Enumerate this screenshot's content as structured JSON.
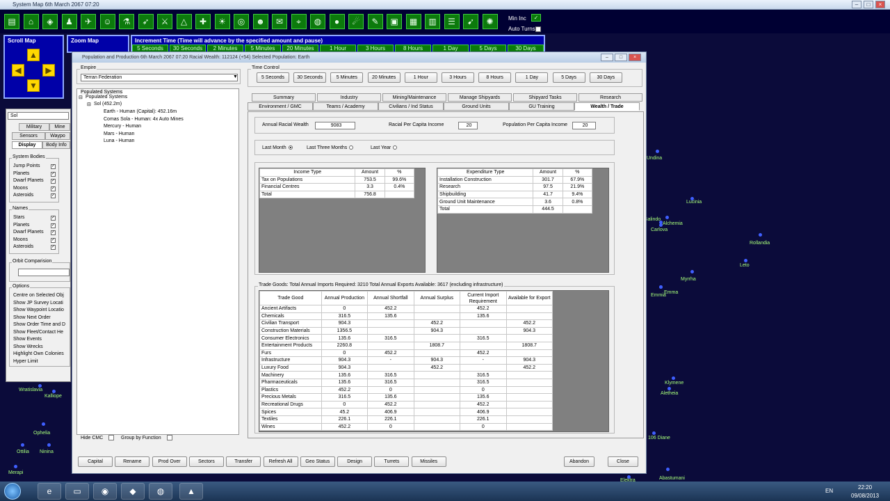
{
  "system_window": {
    "title": "System Map  6th March 2067 07:20"
  },
  "toolbar": {
    "min_inc_label": "Min Inc",
    "auto_turns_label": "Auto Turns",
    "icons": [
      "production-icon",
      "industry-icon",
      "ship-design-icon",
      "pilot-icon",
      "fleet-icon",
      "commander-icon",
      "research-icon",
      "missile-icon",
      "ground-forces-icon",
      "triangle-icon",
      "crosshair-icon",
      "sun-icon",
      "radar-icon",
      "alien-icon",
      "intel-icon",
      "station-icon",
      "globe-icon",
      "planet-icon",
      "satellite-icon",
      "design-icon",
      "monitor-icon",
      "grid-icon",
      "chart-icon",
      "list-icon",
      "rocket-icon",
      "galaxy-icon"
    ]
  },
  "increment": {
    "title": "Increment Time (Time will advance by the specified amount and pause)",
    "buttons": [
      "5 Seconds",
      "30 Seconds",
      "2 Minutes",
      "5 Minutes",
      "20 Minutes",
      "1 Hour",
      "3 Hours",
      "8 Hours",
      "1 Day",
      "5 Days",
      "30 Days"
    ]
  },
  "scroll_map": {
    "title": "Scroll Map"
  },
  "zoom_map": {
    "title": "Zoom Map"
  },
  "left_tools": {
    "search_value": "Sol",
    "tabs_row1": [
      "Military",
      "Mine"
    ],
    "tabs_row2": [
      "Sensors",
      "Waypo"
    ],
    "tabs_row3": [
      "Display",
      "Body Info"
    ],
    "system_bodies": {
      "title": "System Bodies",
      "items": [
        "Jump Points",
        "Planets",
        "Dwarf Planets",
        "Moons",
        "Asteroids"
      ]
    },
    "names": {
      "title": "Names",
      "items": [
        "Stars",
        "Planets",
        "Dwarf Planets",
        "Moons",
        "Asteroids"
      ]
    },
    "orbit": {
      "title": "Orbit Comparision"
    },
    "options": {
      "title": "Options",
      "items": [
        "Centre on Selected Obj",
        "Show JP Survey Locati",
        "Show Waypoint Locatio",
        "Show Next Order",
        "Show Order Time and D",
        "Show Fleet/Contact He",
        "Show Events",
        "Show Wrecks",
        "Highlight Own Colonies",
        "Hyper Limit"
      ]
    }
  },
  "stars": [
    {
      "name": "Lucinia"
    },
    {
      "name": "Galindo"
    },
    {
      "name": "Alchemia"
    },
    {
      "name": "Carlova"
    },
    {
      "name": "Rollandia"
    },
    {
      "name": "Leto"
    },
    {
      "name": "Myrrha"
    },
    {
      "name": "Emma"
    },
    {
      "name": "Emmia"
    },
    {
      "name": "Klymene"
    },
    {
      "name": "Aletheia"
    },
    {
      "name": "106 Diane"
    },
    {
      "name": "Abastumani"
    },
    {
      "name": "Elektra"
    },
    {
      "name": "Undina"
    },
    {
      "name": "Wratislavia"
    },
    {
      "name": "Kalliope"
    },
    {
      "name": "Ophelia"
    },
    {
      "name": "Ottilia"
    },
    {
      "name": "Ninina"
    },
    {
      "name": "Merapi"
    }
  ],
  "dialog": {
    "title": "Population and Production  6th March 2067 07:20    Racial Wealth: 112124 (+54)    Selected Population: Earth",
    "empire": {
      "label": "Empire",
      "value": "Terran Federation"
    },
    "populated": {
      "label": "Populated Systems",
      "root": "Populated Systems",
      "system": "Sol (452.2m)",
      "items": [
        "Earth - Human (Capital): 452.16m",
        "Comas Sola - Human: 4x Auto Mines",
        "Mercury - Human",
        "Mars - Human",
        "Luna - Human"
      ]
    },
    "hide_cmc": "Hide CMC",
    "group_by_function": "Group by Function",
    "time_control": {
      "label": "Time Control",
      "buttons": [
        "5 Seconds",
        "30 Seconds",
        "5 Minutes",
        "20 Minutes",
        "1 Hour",
        "3 Hours",
        "8 Hours",
        "1 Day",
        "5 Days",
        "30 Days"
      ]
    },
    "tabs_row1": [
      "Summary",
      "Industry",
      "Mining/Maintenance",
      "Manage Shipyards",
      "Shipyard Tasks",
      "Research"
    ],
    "tabs_row2": [
      "Environment / GMC",
      "Teams / Academy",
      "Civilians / Ind Status",
      "Ground Units",
      "GU Training",
      "Wealth / Trade"
    ],
    "wealth": {
      "annual_label": "Annual Racial Wealth",
      "annual_value": "9083",
      "per_capita_label": "Racial Per Capita Income",
      "per_capita_value": "20",
      "pop_per_capita_label": "Population Per Capita Income",
      "pop_per_capita_value": "20"
    },
    "period": {
      "last_month": "Last Month",
      "last_three": "Last Three Months",
      "last_year": "Last Year"
    },
    "income": {
      "headers": [
        "Income Type",
        "Amount",
        "%"
      ],
      "rows": [
        [
          "Tax on Populations",
          "753.5",
          "99.6%"
        ],
        [
          "Financial Centres",
          "3.3",
          "0.4%"
        ],
        [
          "Total",
          "756.8",
          ""
        ]
      ]
    },
    "expenditure": {
      "headers": [
        "Expenditure Type",
        "Amount",
        "%"
      ],
      "rows": [
        [
          "Installation Construction",
          "301.7",
          "67.9%"
        ],
        [
          "Research",
          "97.5",
          "21.9%"
        ],
        [
          "Shipbuilding",
          "41.7",
          "9.4%"
        ],
        [
          "Ground Unit Maintenance",
          "3.6",
          "0.8%"
        ],
        [
          "Total",
          "444.5",
          ""
        ]
      ]
    },
    "trade": {
      "summary": "Trade Goods:   Total Annual Imports Required: 3210   Total Annual Exports Available: 3617   (excluding infrastructure)",
      "headers": [
        "Trade Good",
        "Annual Production",
        "Annual Shortfall",
        "Annual Surplus",
        "Current Import Requirement",
        "Available for Export"
      ],
      "rows": [
        [
          "Ancient Artifacts",
          "0",
          "452.2",
          "",
          "452.2",
          ""
        ],
        [
          "Chemicals",
          "316.5",
          "135.6",
          "",
          "135.6",
          ""
        ],
        [
          "Civilian Transport",
          "904.3",
          "",
          "452.2",
          "",
          "452.2"
        ],
        [
          "Construction Materials",
          "1356.5",
          "",
          "904.3",
          "",
          "904.3"
        ],
        [
          "Consumer Electronics",
          "135.6",
          "316.5",
          "",
          "316.5",
          ""
        ],
        [
          "Entertainment Products",
          "2260.8",
          "",
          "1808.7",
          "",
          "1808.7"
        ],
        [
          "Furs",
          "0",
          "452.2",
          "",
          "452.2",
          ""
        ],
        [
          "Infrastructure",
          "904.3",
          "-",
          "904.3",
          "-",
          "904.3"
        ],
        [
          "Luxury Food",
          "904.3",
          "",
          "452.2",
          "",
          "452.2"
        ],
        [
          "Machinery",
          "135.6",
          "316.5",
          "",
          "316.5",
          ""
        ],
        [
          "Pharmaceuticals",
          "135.6",
          "316.5",
          "",
          "316.5",
          ""
        ],
        [
          "Plastics",
          "452.2",
          "0",
          "",
          "0",
          ""
        ],
        [
          "Precious Metals",
          "316.5",
          "135.6",
          "",
          "135.6",
          ""
        ],
        [
          "Recreational Drugs",
          "0",
          "452.2",
          "",
          "452.2",
          ""
        ],
        [
          "Spices",
          "45.2",
          "406.9",
          "",
          "406.9",
          ""
        ],
        [
          "Textiles",
          "226.1",
          "226.1",
          "",
          "226.1",
          ""
        ],
        [
          "Wines",
          "452.2",
          "0",
          "",
          "0",
          ""
        ]
      ]
    },
    "bottom_buttons": [
      "Capital",
      "Rename",
      "Prod Over",
      "Sectors",
      "Transfer",
      "Refresh All",
      "Geo Status",
      "Design",
      "Turrets",
      "Missiles"
    ],
    "abandon": "Abandon",
    "close": "Close"
  },
  "taskbar": {
    "lang": "EN",
    "time": "22:20",
    "date": "09/08/2013"
  }
}
